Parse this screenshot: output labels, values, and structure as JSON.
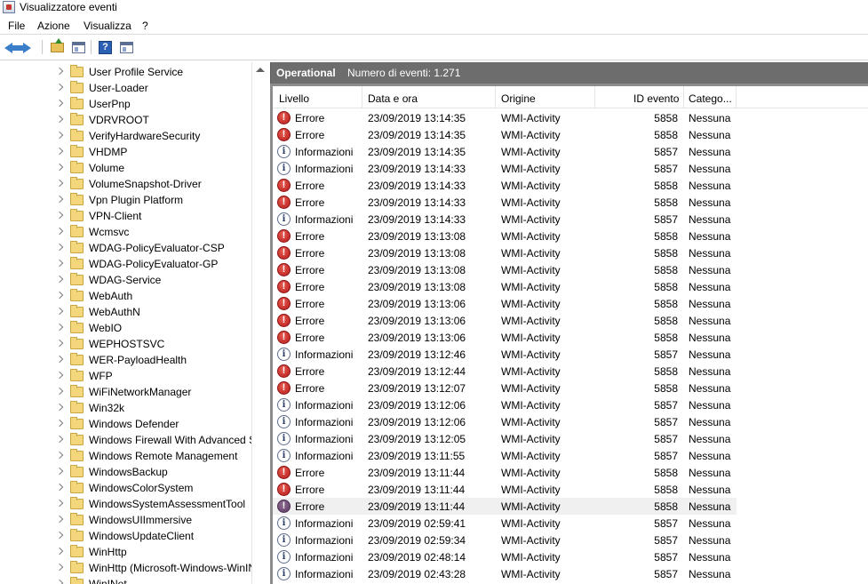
{
  "window": {
    "title": "Visualizzatore eventi"
  },
  "menu": [
    "File",
    "Azione",
    "Visualizza",
    "?"
  ],
  "toolbar": {
    "buttons": [
      "back-icon",
      "forward-icon",
      "folder-up-icon",
      "show-hide-tree-icon",
      "help-icon",
      "show-hide-action-pane-icon"
    ],
    "help_glyph": "?"
  },
  "tree": {
    "items": [
      "User Profile Service",
      "User-Loader",
      "UserPnp",
      "VDRVROOT",
      "VerifyHardwareSecurity",
      "VHDMP",
      "Volume",
      "VolumeSnapshot-Driver",
      "Vpn Plugin Platform",
      "VPN-Client",
      "Wcmsvc",
      "WDAG-PolicyEvaluator-CSP",
      "WDAG-PolicyEvaluator-GP",
      "WDAG-Service",
      "WebAuth",
      "WebAuthN",
      "WebIO",
      "WEPHOSTSVC",
      "WER-PayloadHealth",
      "WFP",
      "WiFiNetworkManager",
      "Win32k",
      "Windows Defender",
      "Windows Firewall With Advanced Security",
      "Windows Remote Management",
      "WindowsBackup",
      "WindowsColorSystem",
      "WindowsSystemAssessmentTool",
      "WindowsUIImmersive",
      "WindowsUpdateClient",
      "WinHttp",
      "WinHttp (Microsoft-Windows-WinINet-Capture)",
      "WinINet"
    ]
  },
  "panel": {
    "title": "Operational",
    "count_label": "Numero di eventi: 1.271"
  },
  "columns": [
    "Livello",
    "Data e ora",
    "Origine",
    "ID evento",
    "Catego..."
  ],
  "glyphs": {
    "error": "!",
    "info": "i"
  },
  "colors": {
    "error": "#c62828",
    "header_bg": "#6d6d6d",
    "selected_row": "#f0f0f0"
  },
  "events": [
    {
      "level": "error",
      "level_label": "Errore",
      "datetime": "23/09/2019 13:14:35",
      "source": "WMI-Activity",
      "id": "5858",
      "category": "Nessuna"
    },
    {
      "level": "error",
      "level_label": "Errore",
      "datetime": "23/09/2019 13:14:35",
      "source": "WMI-Activity",
      "id": "5858",
      "category": "Nessuna"
    },
    {
      "level": "info",
      "level_label": "Informazioni",
      "datetime": "23/09/2019 13:14:35",
      "source": "WMI-Activity",
      "id": "5857",
      "category": "Nessuna"
    },
    {
      "level": "info",
      "level_label": "Informazioni",
      "datetime": "23/09/2019 13:14:33",
      "source": "WMI-Activity",
      "id": "5857",
      "category": "Nessuna"
    },
    {
      "level": "error",
      "level_label": "Errore",
      "datetime": "23/09/2019 13:14:33",
      "source": "WMI-Activity",
      "id": "5858",
      "category": "Nessuna"
    },
    {
      "level": "error",
      "level_label": "Errore",
      "datetime": "23/09/2019 13:14:33",
      "source": "WMI-Activity",
      "id": "5858",
      "category": "Nessuna"
    },
    {
      "level": "info",
      "level_label": "Informazioni",
      "datetime": "23/09/2019 13:14:33",
      "source": "WMI-Activity",
      "id": "5857",
      "category": "Nessuna"
    },
    {
      "level": "error",
      "level_label": "Errore",
      "datetime": "23/09/2019 13:13:08",
      "source": "WMI-Activity",
      "id": "5858",
      "category": "Nessuna"
    },
    {
      "level": "error",
      "level_label": "Errore",
      "datetime": "23/09/2019 13:13:08",
      "source": "WMI-Activity",
      "id": "5858",
      "category": "Nessuna"
    },
    {
      "level": "error",
      "level_label": "Errore",
      "datetime": "23/09/2019 13:13:08",
      "source": "WMI-Activity",
      "id": "5858",
      "category": "Nessuna"
    },
    {
      "level": "error",
      "level_label": "Errore",
      "datetime": "23/09/2019 13:13:08",
      "source": "WMI-Activity",
      "id": "5858",
      "category": "Nessuna"
    },
    {
      "level": "error",
      "level_label": "Errore",
      "datetime": "23/09/2019 13:13:06",
      "source": "WMI-Activity",
      "id": "5858",
      "category": "Nessuna"
    },
    {
      "level": "error",
      "level_label": "Errore",
      "datetime": "23/09/2019 13:13:06",
      "source": "WMI-Activity",
      "id": "5858",
      "category": "Nessuna"
    },
    {
      "level": "error",
      "level_label": "Errore",
      "datetime": "23/09/2019 13:13:06",
      "source": "WMI-Activity",
      "id": "5858",
      "category": "Nessuna"
    },
    {
      "level": "info",
      "level_label": "Informazioni",
      "datetime": "23/09/2019 13:12:46",
      "source": "WMI-Activity",
      "id": "5857",
      "category": "Nessuna"
    },
    {
      "level": "error",
      "level_label": "Errore",
      "datetime": "23/09/2019 13:12:44",
      "source": "WMI-Activity",
      "id": "5858",
      "category": "Nessuna"
    },
    {
      "level": "error",
      "level_label": "Errore",
      "datetime": "23/09/2019 13:12:07",
      "source": "WMI-Activity",
      "id": "5858",
      "category": "Nessuna"
    },
    {
      "level": "info",
      "level_label": "Informazioni",
      "datetime": "23/09/2019 13:12:06",
      "source": "WMI-Activity",
      "id": "5857",
      "category": "Nessuna"
    },
    {
      "level": "info",
      "level_label": "Informazioni",
      "datetime": "23/09/2019 13:12:06",
      "source": "WMI-Activity",
      "id": "5857",
      "category": "Nessuna"
    },
    {
      "level": "info",
      "level_label": "Informazioni",
      "datetime": "23/09/2019 13:12:05",
      "source": "WMI-Activity",
      "id": "5857",
      "category": "Nessuna"
    },
    {
      "level": "info",
      "level_label": "Informazioni",
      "datetime": "23/09/2019 13:11:55",
      "source": "WMI-Activity",
      "id": "5857",
      "category": "Nessuna"
    },
    {
      "level": "error",
      "level_label": "Errore",
      "datetime": "23/09/2019 13:11:44",
      "source": "WMI-Activity",
      "id": "5858",
      "category": "Nessuna"
    },
    {
      "level": "error",
      "level_label": "Errore",
      "datetime": "23/09/2019 13:11:44",
      "source": "WMI-Activity",
      "id": "5858",
      "category": "Nessuna"
    },
    {
      "level": "error",
      "level_label": "Errore",
      "datetime": "23/09/2019 13:11:44",
      "source": "WMI-Activity",
      "id": "5858",
      "category": "Nessuna",
      "selected": true
    },
    {
      "level": "info",
      "level_label": "Informazioni",
      "datetime": "23/09/2019 02:59:41",
      "source": "WMI-Activity",
      "id": "5857",
      "category": "Nessuna"
    },
    {
      "level": "info",
      "level_label": "Informazioni",
      "datetime": "23/09/2019 02:59:34",
      "source": "WMI-Activity",
      "id": "5857",
      "category": "Nessuna"
    },
    {
      "level": "info",
      "level_label": "Informazioni",
      "datetime": "23/09/2019 02:48:14",
      "source": "WMI-Activity",
      "id": "5857",
      "category": "Nessuna"
    },
    {
      "level": "info",
      "level_label": "Informazioni",
      "datetime": "23/09/2019 02:43:28",
      "source": "WMI-Activity",
      "id": "5857",
      "category": "Nessuna"
    }
  ]
}
